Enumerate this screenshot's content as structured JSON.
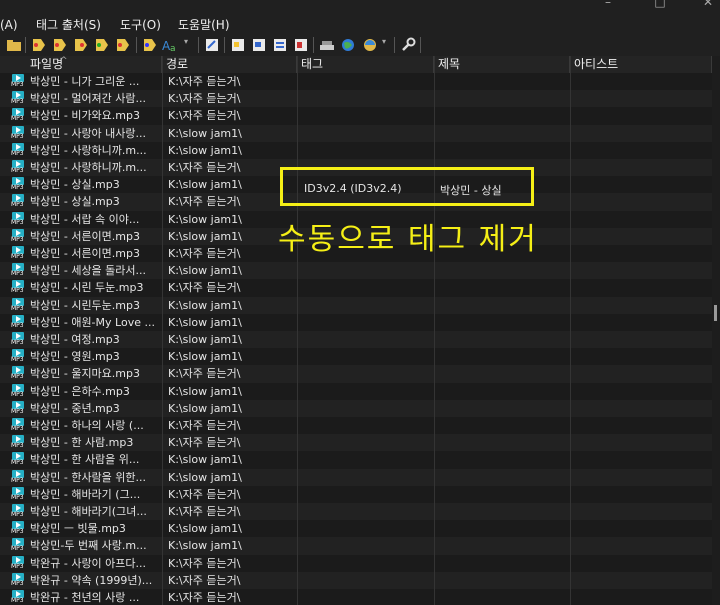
{
  "menu": {
    "item_a": "(A)",
    "tag_export": "태그 출처(S)",
    "tools": "도구(O)",
    "help": "도움말(H)"
  },
  "columns": {
    "filename": "파일명",
    "path": "경로",
    "tag": "태그",
    "title": "제목",
    "artist": "아티스트"
  },
  "rows": [
    {
      "filename": "박상민 - 니가 그리운 ...",
      "path": "K:\\자주 듣는거\\"
    },
    {
      "filename": "박상민 - 멀어져간 사람...",
      "path": "K:\\자주 듣는거\\"
    },
    {
      "filename": "박상민 - 비가와요.mp3",
      "path": "K:\\자주 듣는거\\"
    },
    {
      "filename": "박상민 - 사랑아 내사랑...",
      "path": "K:\\slow jam1\\"
    },
    {
      "filename": "박상민 - 사랑하니까.m...",
      "path": "K:\\slow jam1\\"
    },
    {
      "filename": "박상민 - 사랑하니까.m...",
      "path": "K:\\자주 듣는거\\"
    },
    {
      "filename": "박상민 - 상실.mp3",
      "path": "K:\\slow jam1\\"
    },
    {
      "filename": "박상민 - 상실.mp3",
      "path": "K:\\자주 듣는거\\"
    },
    {
      "filename": "박상민 - 서랍 속 이야...",
      "path": "K:\\slow jam1\\"
    },
    {
      "filename": "박상민 - 서른이면.mp3",
      "path": "K:\\slow jam1\\"
    },
    {
      "filename": "박상민 - 서른이면.mp3",
      "path": "K:\\자주 듣는거\\"
    },
    {
      "filename": "박상민 - 세상을 돌라서...",
      "path": "K:\\slow jam1\\"
    },
    {
      "filename": "박상민 - 시린 두눈.mp3",
      "path": "K:\\자주 듣는거\\"
    },
    {
      "filename": "박상민 - 시린두눈.mp3",
      "path": "K:\\slow jam1\\"
    },
    {
      "filename": "박상민 - 애원-My Love ...",
      "path": "K:\\slow jam1\\"
    },
    {
      "filename": "박상민 - 여정.mp3",
      "path": "K:\\slow jam1\\"
    },
    {
      "filename": "박상민 - 영원.mp3",
      "path": "K:\\slow jam1\\"
    },
    {
      "filename": "박상민 - 울지마요.mp3",
      "path": "K:\\자주 듣는거\\"
    },
    {
      "filename": "박상민 - 은하수.mp3",
      "path": "K:\\slow jam1\\"
    },
    {
      "filename": "박상민 - 중년.mp3",
      "path": "K:\\slow jam1\\"
    },
    {
      "filename": "박상민 - 하나의 사랑 (...",
      "path": "K:\\자주 듣는거\\"
    },
    {
      "filename": "박상민 - 한 사람.mp3",
      "path": "K:\\자주 듣는거\\"
    },
    {
      "filename": "박상민 - 한 사람을 위...",
      "path": "K:\\slow jam1\\"
    },
    {
      "filename": "박상민 - 한사람을 위한...",
      "path": "K:\\slow jam1\\"
    },
    {
      "filename": "박상민 - 해바라기 (그...",
      "path": "K:\\자주 듣는거\\"
    },
    {
      "filename": "박상민 - 해바라기(그녀...",
      "path": "K:\\자주 듣는거\\"
    },
    {
      "filename": "박상민 ㅡ 빗물.mp3",
      "path": "K:\\slow jam1\\"
    },
    {
      "filename": "박상민-두 번째 사랑.m...",
      "path": "K:\\slow jam1\\"
    },
    {
      "filename": "박완규 - 사랑이 아프다...",
      "path": "K:\\자주 듣는거\\"
    },
    {
      "filename": "박완규 - 약속 (1999년)...",
      "path": "K:\\자주 듣는거\\"
    },
    {
      "filename": "박완규 - 천년의 사랑 ...",
      "path": "K:\\자주 듣는거\\"
    }
  ],
  "highlight": {
    "tag": "ID3v2.4 (ID3v2.4)",
    "title": "박상민 - 상실"
  },
  "annotation": "수동으로 태그 제거",
  "icon_label": "MP3",
  "colors": {
    "highlight": "#f5ef16",
    "icon": "#26b0c6",
    "background": "#1b1b1b"
  }
}
